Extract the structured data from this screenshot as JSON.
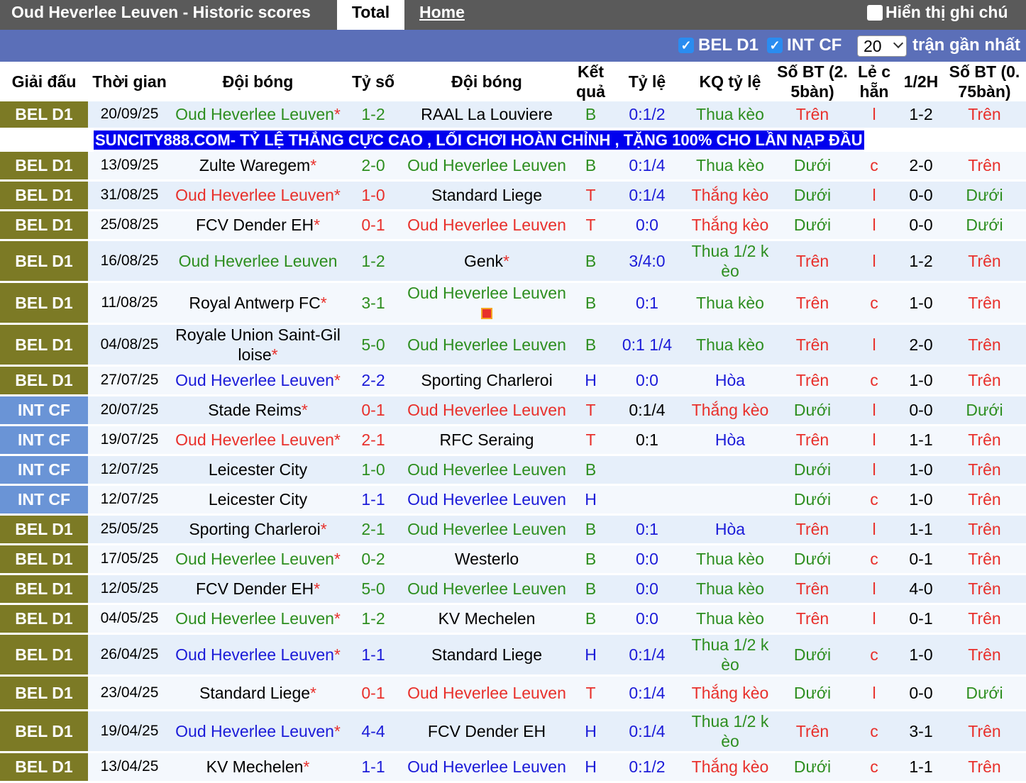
{
  "header": {
    "title": "Oud Heverlee Leuven - Historic scores",
    "tab_total": "Total",
    "tab_home": "Home",
    "note_toggle": "Hiển thị ghi chú"
  },
  "filters": {
    "bel": "BEL D1",
    "int": "INT CF",
    "count": "20",
    "recent_label": "trận gần nhất"
  },
  "columns": [
    "Giải đấu",
    "Thời gian",
    "Đội bóng",
    "Tỷ số",
    "Đội bóng",
    "Kết quả",
    "Tỷ lệ",
    "KQ tỷ lệ",
    "Số BT (2. 5bàn)",
    "Lẻ c hẵn",
    "1/2H",
    "Số BT (0. 75bàn)"
  ],
  "ad": "SUNCITY888.COM- TỶ LỆ THẮNG CỰC CAO , LỐI CHƠI HOÀN CHỈNH , TẶNG 100% CHO LẦN NẠP ĐẦU",
  "colors": {
    "win": "#e8302b",
    "loss": "#2d8e1f",
    "draw": "#1b1bd8",
    "bel_badge": "#7c7a25",
    "int_badge": "#6a94d6",
    "ad_bg": "#0000ee"
  },
  "matches": [
    {
      "league": "BEL D1",
      "date": "20/09/25",
      "home": "Oud Heverlee Leuven",
      "home_star": "*",
      "home_color": "green",
      "score": "1-2",
      "away": "RAAL La Louviere",
      "away_star": "",
      "away_color": "black",
      "result": "B",
      "odds": "0:1/2",
      "odds_color": "blue",
      "odds_result": "Thua kèo",
      "ou": "Trên",
      "oe": "l",
      "half": "1-2",
      "ou2": "Trên"
    },
    {
      "league": "BEL D1",
      "date": "13/09/25",
      "home": "Zulte Waregem",
      "home_star": "*",
      "home_color": "black",
      "score": "2-0",
      "away": "Oud Heverlee Leuven",
      "away_star": "",
      "away_color": "green",
      "result": "B",
      "odds": "0:1/4",
      "odds_color": "blue",
      "odds_result": "Thua kèo",
      "ou": "Dưới",
      "oe": "c",
      "half": "2-0",
      "ou2": "Trên"
    },
    {
      "league": "BEL D1",
      "date": "31/08/25",
      "home": "Oud Heverlee Leuven",
      "home_star": "*",
      "home_color": "red",
      "score": "1-0",
      "away": "Standard Liege",
      "away_star": "",
      "away_color": "black",
      "result": "T",
      "odds": "0:1/4",
      "odds_color": "blue",
      "odds_result": "Thắng kèo",
      "ou": "Dưới",
      "oe": "l",
      "half": "0-0",
      "ou2": "Dưới"
    },
    {
      "league": "BEL D1",
      "date": "25/08/25",
      "home": "FCV Dender EH",
      "home_star": "*",
      "home_color": "black",
      "score": "0-1",
      "away": "Oud Heverlee Leuven",
      "away_star": "",
      "away_color": "red",
      "result": "T",
      "odds": "0:0",
      "odds_color": "blue",
      "odds_result": "Thắng kèo",
      "ou": "Dưới",
      "oe": "l",
      "half": "0-0",
      "ou2": "Dưới"
    },
    {
      "league": "BEL D1",
      "date": "16/08/25",
      "home": "Oud Heverlee Leuven",
      "home_star": "",
      "home_color": "green",
      "score": "1-2",
      "away": "Genk",
      "away_star": "*",
      "away_color": "black",
      "result": "B",
      "odds": "3/4:0",
      "odds_color": "blue",
      "odds_result": "Thua 1/2 k èo",
      "ou": "Trên",
      "oe": "l",
      "half": "1-2",
      "ou2": "Trên"
    },
    {
      "league": "BEL D1",
      "date": "11/08/25",
      "home": "Royal Antwerp FC",
      "home_star": "*",
      "home_color": "black",
      "score": "3-1",
      "away": "Oud Heverlee Leuven",
      "away_star": "",
      "away_color": "green",
      "away_flag": true,
      "result": "B",
      "odds": "0:1",
      "odds_color": "blue",
      "odds_result": "Thua kèo",
      "ou": "Trên",
      "oe": "c",
      "half": "1-0",
      "ou2": "Trên"
    },
    {
      "league": "BEL D1",
      "date": "04/08/25",
      "home": "Royale Union Saint-Gil loise",
      "home_star": "*",
      "home_color": "black",
      "score": "5-0",
      "away": "Oud Heverlee Leuven",
      "away_star": "",
      "away_color": "green",
      "result": "B",
      "odds": "0:1 1/4",
      "odds_color": "blue",
      "odds_result": "Thua kèo",
      "ou": "Trên",
      "oe": "l",
      "half": "2-0",
      "ou2": "Trên"
    },
    {
      "league": "BEL D1",
      "date": "27/07/25",
      "home": "Oud Heverlee Leuven",
      "home_star": "*",
      "home_color": "blue",
      "score": "2-2",
      "away": "Sporting Charleroi",
      "away_star": "",
      "away_color": "black",
      "result": "H",
      "odds": "0:0",
      "odds_color": "blue",
      "odds_result": "Hòa",
      "ou": "Trên",
      "oe": "c",
      "half": "1-0",
      "ou2": "Trên"
    },
    {
      "league": "INT CF",
      "date": "20/07/25",
      "home": "Stade Reims",
      "home_star": "*",
      "home_color": "black",
      "score": "0-1",
      "away": "Oud Heverlee Leuven",
      "away_star": "",
      "away_color": "red",
      "result": "T",
      "odds": "0:1/4",
      "odds_color": "black",
      "odds_result": "Thắng kèo",
      "ou": "Dưới",
      "oe": "l",
      "half": "0-0",
      "ou2": "Dưới"
    },
    {
      "league": "INT CF",
      "date": "19/07/25",
      "home": "Oud Heverlee Leuven",
      "home_star": "*",
      "home_color": "red",
      "score": "2-1",
      "away": "RFC Seraing",
      "away_star": "",
      "away_color": "black",
      "result": "T",
      "odds": "0:1",
      "odds_color": "black",
      "odds_result": "Hòa",
      "ou": "Trên",
      "oe": "l",
      "half": "1-1",
      "ou2": "Trên"
    },
    {
      "league": "INT CF",
      "date": "12/07/25",
      "home": "Leicester City",
      "home_star": "",
      "home_color": "black",
      "score": "1-0",
      "away": "Oud Heverlee Leuven",
      "away_star": "",
      "away_color": "green",
      "result": "B",
      "odds": "",
      "odds_color": "black",
      "odds_result": "",
      "ou": "Dưới",
      "oe": "l",
      "half": "1-0",
      "ou2": "Trên"
    },
    {
      "league": "INT CF",
      "date": "12/07/25",
      "home": "Leicester City",
      "home_star": "",
      "home_color": "black",
      "score": "1-1",
      "away": "Oud Heverlee Leuven",
      "away_star": "",
      "away_color": "blue",
      "result": "H",
      "odds": "",
      "odds_color": "black",
      "odds_result": "",
      "ou": "Dưới",
      "oe": "c",
      "half": "1-0",
      "ou2": "Trên"
    },
    {
      "league": "BEL D1",
      "date": "25/05/25",
      "home": "Sporting Charleroi",
      "home_star": "*",
      "home_color": "black",
      "score": "2-1",
      "away": "Oud Heverlee Leuven",
      "away_star": "",
      "away_color": "green",
      "result": "B",
      "odds": "0:1",
      "odds_color": "blue",
      "odds_result": "Hòa",
      "ou": "Trên",
      "oe": "l",
      "half": "1-1",
      "ou2": "Trên"
    },
    {
      "league": "BEL D1",
      "date": "17/05/25",
      "home": "Oud Heverlee Leuven",
      "home_star": "*",
      "home_color": "green",
      "score": "0-2",
      "away": "Westerlo",
      "away_star": "",
      "away_color": "black",
      "result": "B",
      "odds": "0:0",
      "odds_color": "blue",
      "odds_result": "Thua kèo",
      "ou": "Dưới",
      "oe": "c",
      "half": "0-1",
      "ou2": "Trên"
    },
    {
      "league": "BEL D1",
      "date": "12/05/25",
      "home": "FCV Dender EH",
      "home_star": "*",
      "home_color": "black",
      "score": "5-0",
      "away": "Oud Heverlee Leuven",
      "away_star": "",
      "away_color": "green",
      "result": "B",
      "odds": "0:0",
      "odds_color": "blue",
      "odds_result": "Thua kèo",
      "ou": "Trên",
      "oe": "l",
      "half": "4-0",
      "ou2": "Trên"
    },
    {
      "league": "BEL D1",
      "date": "04/05/25",
      "home": "Oud Heverlee Leuven",
      "home_star": "*",
      "home_color": "green",
      "score": "1-2",
      "away": "KV Mechelen",
      "away_star": "",
      "away_color": "black",
      "result": "B",
      "odds": "0:0",
      "odds_color": "blue",
      "odds_result": "Thua kèo",
      "ou": "Trên",
      "oe": "l",
      "half": "0-1",
      "ou2": "Trên"
    },
    {
      "league": "BEL D1",
      "date": "26/04/25",
      "home": "Oud Heverlee Leuven",
      "home_star": "*",
      "home_color": "blue",
      "score": "1-1",
      "away": "Standard Liege",
      "away_star": "",
      "away_color": "black",
      "result": "H",
      "odds": "0:1/4",
      "odds_color": "blue",
      "odds_result": "Thua 1/2 k èo",
      "ou": "Dưới",
      "oe": "c",
      "half": "1-0",
      "ou2": "Trên"
    },
    {
      "league": "BEL D1",
      "date": "23/04/25",
      "home": "Standard Liege",
      "home_star": "*",
      "home_color": "black",
      "score": "0-1",
      "away": "Oud Heverlee Leuven",
      "away_star": "",
      "away_color": "red",
      "result": "T",
      "odds": "0:1/4",
      "odds_color": "blue",
      "odds_result": "Thắng kèo",
      "ou": "Dưới",
      "oe": "l",
      "half": "0-0",
      "ou2": "Dưới"
    },
    {
      "league": "BEL D1",
      "date": "19/04/25",
      "home": "Oud Heverlee Leuven",
      "home_star": "*",
      "home_color": "blue",
      "score": "4-4",
      "away": "FCV Dender EH",
      "away_star": "",
      "away_color": "black",
      "result": "H",
      "odds": "0:1/4",
      "odds_color": "blue",
      "odds_result": "Thua 1/2 k èo",
      "ou": "Trên",
      "oe": "c",
      "half": "3-1",
      "ou2": "Trên"
    },
    {
      "league": "BEL D1",
      "date": "13/04/25",
      "home": "KV Mechelen",
      "home_star": "*",
      "home_color": "black",
      "score": "1-1",
      "away": "Oud Heverlee Leuven",
      "away_star": "",
      "away_color": "blue",
      "result": "H",
      "odds": "0:1/2",
      "odds_color": "blue",
      "odds_result": "Thắng kèo",
      "ou": "Dưới",
      "oe": "c",
      "half": "1-1",
      "ou2": "Trên"
    }
  ]
}
